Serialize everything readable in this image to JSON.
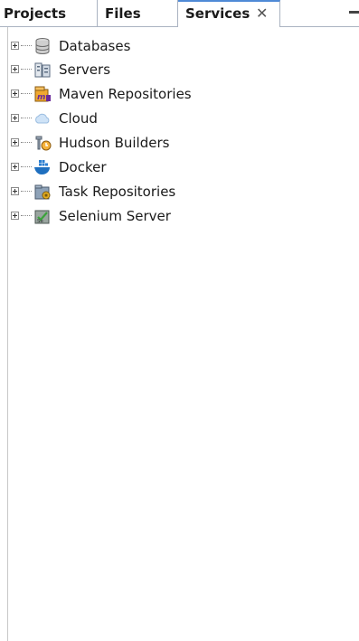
{
  "tabs": [
    {
      "label": "Projects",
      "active": false
    },
    {
      "label": "Files",
      "active": false
    },
    {
      "label": "Services",
      "active": true
    }
  ],
  "close_glyph": "✕",
  "tree": {
    "items": [
      {
        "label": "Databases",
        "icon": "database-icon"
      },
      {
        "label": "Servers",
        "icon": "servers-icon"
      },
      {
        "label": "Maven Repositories",
        "icon": "maven-repositories-icon"
      },
      {
        "label": "Cloud",
        "icon": "cloud-icon"
      },
      {
        "label": "Hudson Builders",
        "icon": "hudson-builders-icon"
      },
      {
        "label": "Docker",
        "icon": "docker-icon"
      },
      {
        "label": "Task Repositories",
        "icon": "task-repositories-icon"
      },
      {
        "label": "Selenium Server",
        "icon": "selenium-server-icon"
      }
    ]
  },
  "colors": {
    "active_tab_accent": "#4f8ad6",
    "border": "#aab3c1",
    "text": "#1a1a1a"
  }
}
